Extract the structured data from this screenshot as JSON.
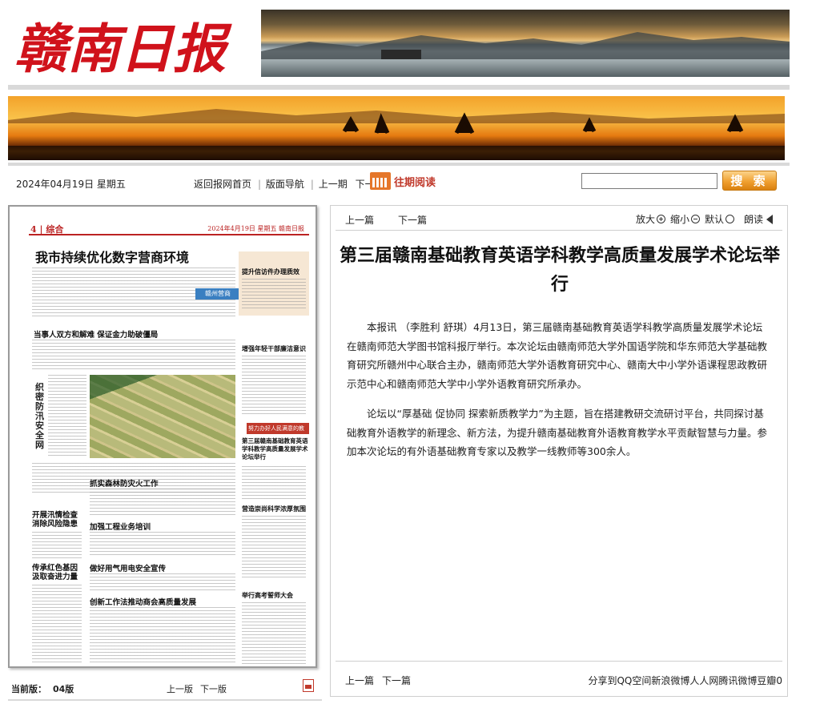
{
  "header": {
    "logo_text": "赣南日报"
  },
  "toolbar": {
    "date": "2024年04月19日 星期五",
    "nav_links": [
      "返回报网首页",
      "版面导航",
      "上一期",
      "下一期"
    ],
    "archive_label": "往期阅读",
    "search_placeholder": "",
    "search_button": "搜 索"
  },
  "newspaper_page": {
    "section": "4 | 综合",
    "masthead": "2024年4月19日 星期五  赣南日报",
    "headline": "我市持续优化数字营商环境",
    "headlines": [
      "当事人双方和解难  保证金力助破僵局",
      "织密防汛安全网",
      "开展汛情检查 消除风险隐患",
      "传承红色基因 汲取奋进力量",
      "抓实森林防灾火工作",
      "加强工程业务培训",
      "做好用气用电安全宣传",
      "创新工作法推动商会高质量发展",
      "提升信访件办理质效",
      "增强年轻干部廉洁意识",
      "第三届赣南基础教育英语学科教学高质量发展学术论坛举行",
      "营造崇尚科学浓厚氛围",
      "举行高考誓师大会"
    ],
    "tag": "赣州营商",
    "red_banner": "努力办好人民满意的教育"
  },
  "page_footer": {
    "current_label": "当前版：",
    "current_value": "04版",
    "prev": "上一版",
    "next": "下一版"
  },
  "article": {
    "prev": "上一篇",
    "next": "下一篇",
    "zoom_in": "放大",
    "zoom_out": "缩小",
    "default": "默认",
    "read_aloud": "朗读",
    "title": "第三届赣南基础教育英语学科教学高质量发展学术论坛举行",
    "paragraphs": [
      "本报讯 （李胜利 舒琪）4月13日，第三届赣南基础教育英语学科教学高质量发展学术论坛在赣南师范大学图书馆科报厅举行。本次论坛由赣南师范大学外国语学院和华东师范大学基础教育研究所赣州中心联合主办，赣南师范大学外语教育研究中心、赣南大中小学外语课程思政教研示范中心和赣南师范大学中小学外语教育研究所承办。",
      "论坛以“厚基础 促协同 探索新质教学力”为主题，旨在搭建教研交流研讨平台，共同探讨基础教育外语教学的新理念、新方法，为提升赣南基础教育外语教育教学水平贡献智慧与力量。参加本次论坛的有外语基础教育专家以及教学一线教师等300余人。"
    ],
    "bottom_prev": "上一篇",
    "bottom_next": "下一篇",
    "share": "分享到QQ空间新浪微博人人网腾讯微博豆瓣0"
  },
  "colors": {
    "logo_red": "#d0121b",
    "accent_orange": "#f0a030",
    "link_red": "#c0392b"
  }
}
